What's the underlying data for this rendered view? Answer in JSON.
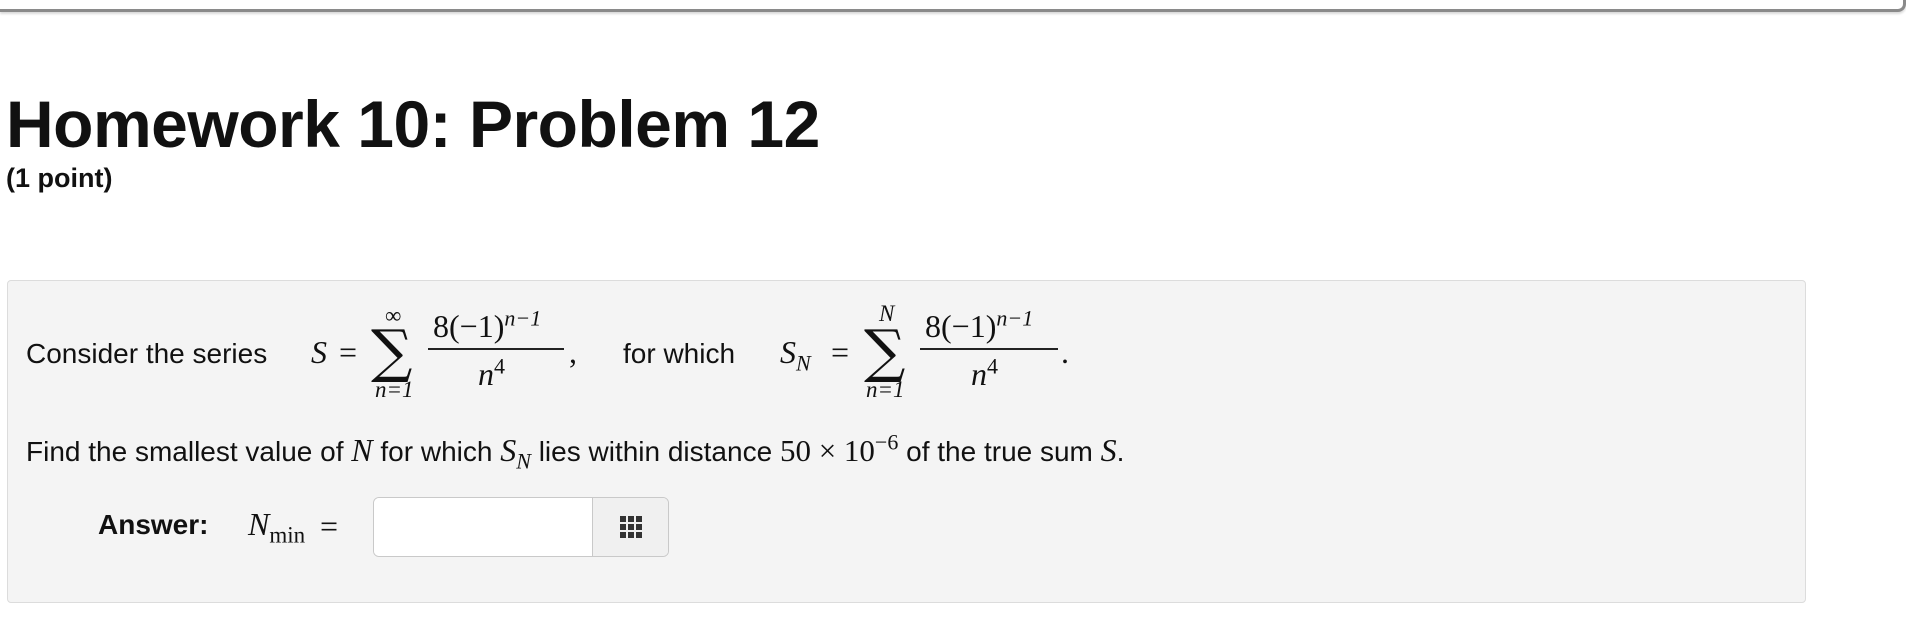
{
  "header": {
    "title": "Homework 10: Problem 12",
    "points": "(1 point)"
  },
  "problem": {
    "intro_text": "Consider the series",
    "series": {
      "lhs": "S",
      "equals": "=",
      "sum_upper": "∞",
      "sum_lower": "n=1",
      "numerator_coef": "8(−1)",
      "numerator_exp": "n−1",
      "denominator_base": "n",
      "denominator_exp": "4",
      "trailing": ","
    },
    "connector_text": "for which",
    "partial_sum": {
      "lhs": "S",
      "lhs_sub": "N",
      "equals": "=",
      "sum_upper": "N",
      "sum_lower": "n=1",
      "numerator_coef": "8(−1)",
      "numerator_exp": "n−1",
      "denominator_base": "n",
      "denominator_exp": "4",
      "trailing": "."
    },
    "question": {
      "part1": "Find the smallest value of",
      "var_N": "N",
      "part2": "for which",
      "var_S": "S",
      "var_S_sub": "N",
      "part3": "lies within distance",
      "distance_base": "50 × 10",
      "distance_exp": "−6",
      "part4": "of the true sum",
      "var_S_true": "S",
      "period": "."
    }
  },
  "answer": {
    "label": "Answer:",
    "var": "N",
    "var_sub": "min",
    "equals": "=",
    "value": "",
    "placeholder": ""
  },
  "icons": {
    "equation_editor": "grid-icon"
  }
}
